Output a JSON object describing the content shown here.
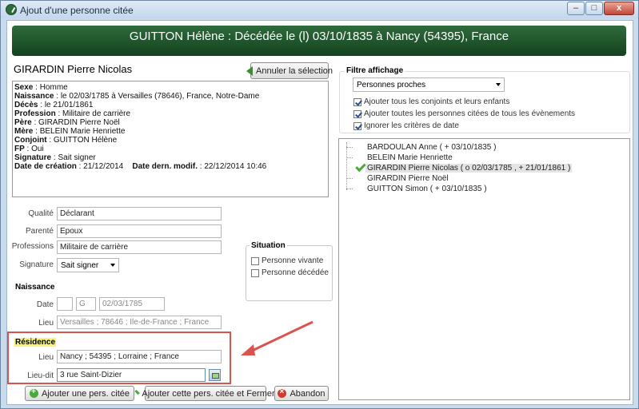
{
  "window": {
    "title": "Ajout d'une personne citée",
    "minimize_label": "–",
    "maximize_label": "□",
    "close_label": "x"
  },
  "banner": {
    "text": "GUITTON Hélène : Décédée le (l) 03/10/1835 à Nancy (54395), France",
    "color": "#1f5a2c"
  },
  "person": {
    "name": "GIRARDIN Pierre Nicolas",
    "cancel_selection_label": "Annuler la sélection",
    "details": [
      {
        "key": "Sexe",
        "sep": " : ",
        "value": "Homme"
      },
      {
        "key": "Naissance",
        "sep": " : ",
        "value": "le 02/03/1785 à Versailles (78646), France, Notre-Dame"
      },
      {
        "key": "Décès",
        "sep": " : ",
        "value": "le 21/01/1861"
      },
      {
        "key": "Profession",
        "sep": " : ",
        "value": "Militaire de carrière"
      },
      {
        "key": "Père",
        "sep": " : ",
        "value": "GIRARDIN Pierre Noël"
      },
      {
        "key": "Mère",
        "sep": " : ",
        "value": "BELEIN Marie Henriette"
      },
      {
        "key": "Conjoint",
        "sep": " : ",
        "value": "GUITTON Hélène"
      },
      {
        "key": "FP",
        "sep": " : ",
        "value": "Oui"
      },
      {
        "key": "Signature",
        "sep": " : ",
        "value": "Sait signer"
      }
    ],
    "creation_label": "Date de création",
    "creation_value": "21/12/2014",
    "modif_label": "Date dern. modif.",
    "modif_value": "22/12/2014 10:46"
  },
  "form": {
    "qualite_label": "Qualité",
    "qualite_value": "Déclarant",
    "parente_label": "Parenté",
    "parente_value": "Epoux",
    "professions_label": "Professions",
    "professions_value": "Militaire de carrière",
    "signature_label": "Signature",
    "signature_value": "Sait signer"
  },
  "situation": {
    "title": "Situation",
    "vivante_label": "Personne vivante",
    "vivante_checked": false,
    "decedee_label": "Personne décédée",
    "decedee_checked": false
  },
  "naissance": {
    "title": "Naissance",
    "date_label": "Date",
    "date_prefix": "",
    "date_calendar": "G",
    "date_value": "02/03/1785",
    "lieu_label": "Lieu",
    "lieu_value": "Versailles ; 78646 ; Ile-de-France ; France"
  },
  "residence": {
    "title": "Résidence",
    "lieu_label": "Lieu",
    "lieu_value": "Nancy ; 54395 ; Lorraine ; France",
    "lieudit_label": "Lieu-dit",
    "lieudit_value": "3 rue Saint-Dizier"
  },
  "filter": {
    "title": "Filtre affichage",
    "selected": "Personnes proches",
    "options": [
      {
        "label": "Ajouter tous les conjoints et leurs enfants",
        "checked": true
      },
      {
        "label": "Ajouter toutes les personnes citées de tous les évènements",
        "checked": true
      },
      {
        "label": "Ignorer les critères de date",
        "checked": true
      }
    ]
  },
  "people_list": [
    {
      "label": "BARDOULAN Anne ( + 03/10/1835 )",
      "selected": false,
      "checked": false
    },
    {
      "label": "BELEIN Marie Henriette",
      "selected": false,
      "checked": false
    },
    {
      "label": "GIRARDIN Pierre Nicolas ( o 02/03/1785 , + 21/01/1861 )",
      "selected": true,
      "checked": true
    },
    {
      "label": "GIRARDIN Pierre Noël",
      "selected": false,
      "checked": false
    },
    {
      "label": "GUITTON Simon ( + 03/10/1835 )",
      "selected": false,
      "checked": false
    }
  ],
  "buttons": {
    "add_label": "Ajouter une pers. citée",
    "add_close_label": "Ajouter cette pers. citée et Fermer",
    "cancel_label": "Abandon"
  },
  "colors": {
    "highlight_border": "#d9534f",
    "residence_highlight": "#f6f27a",
    "check_green": "#4aa93a"
  }
}
